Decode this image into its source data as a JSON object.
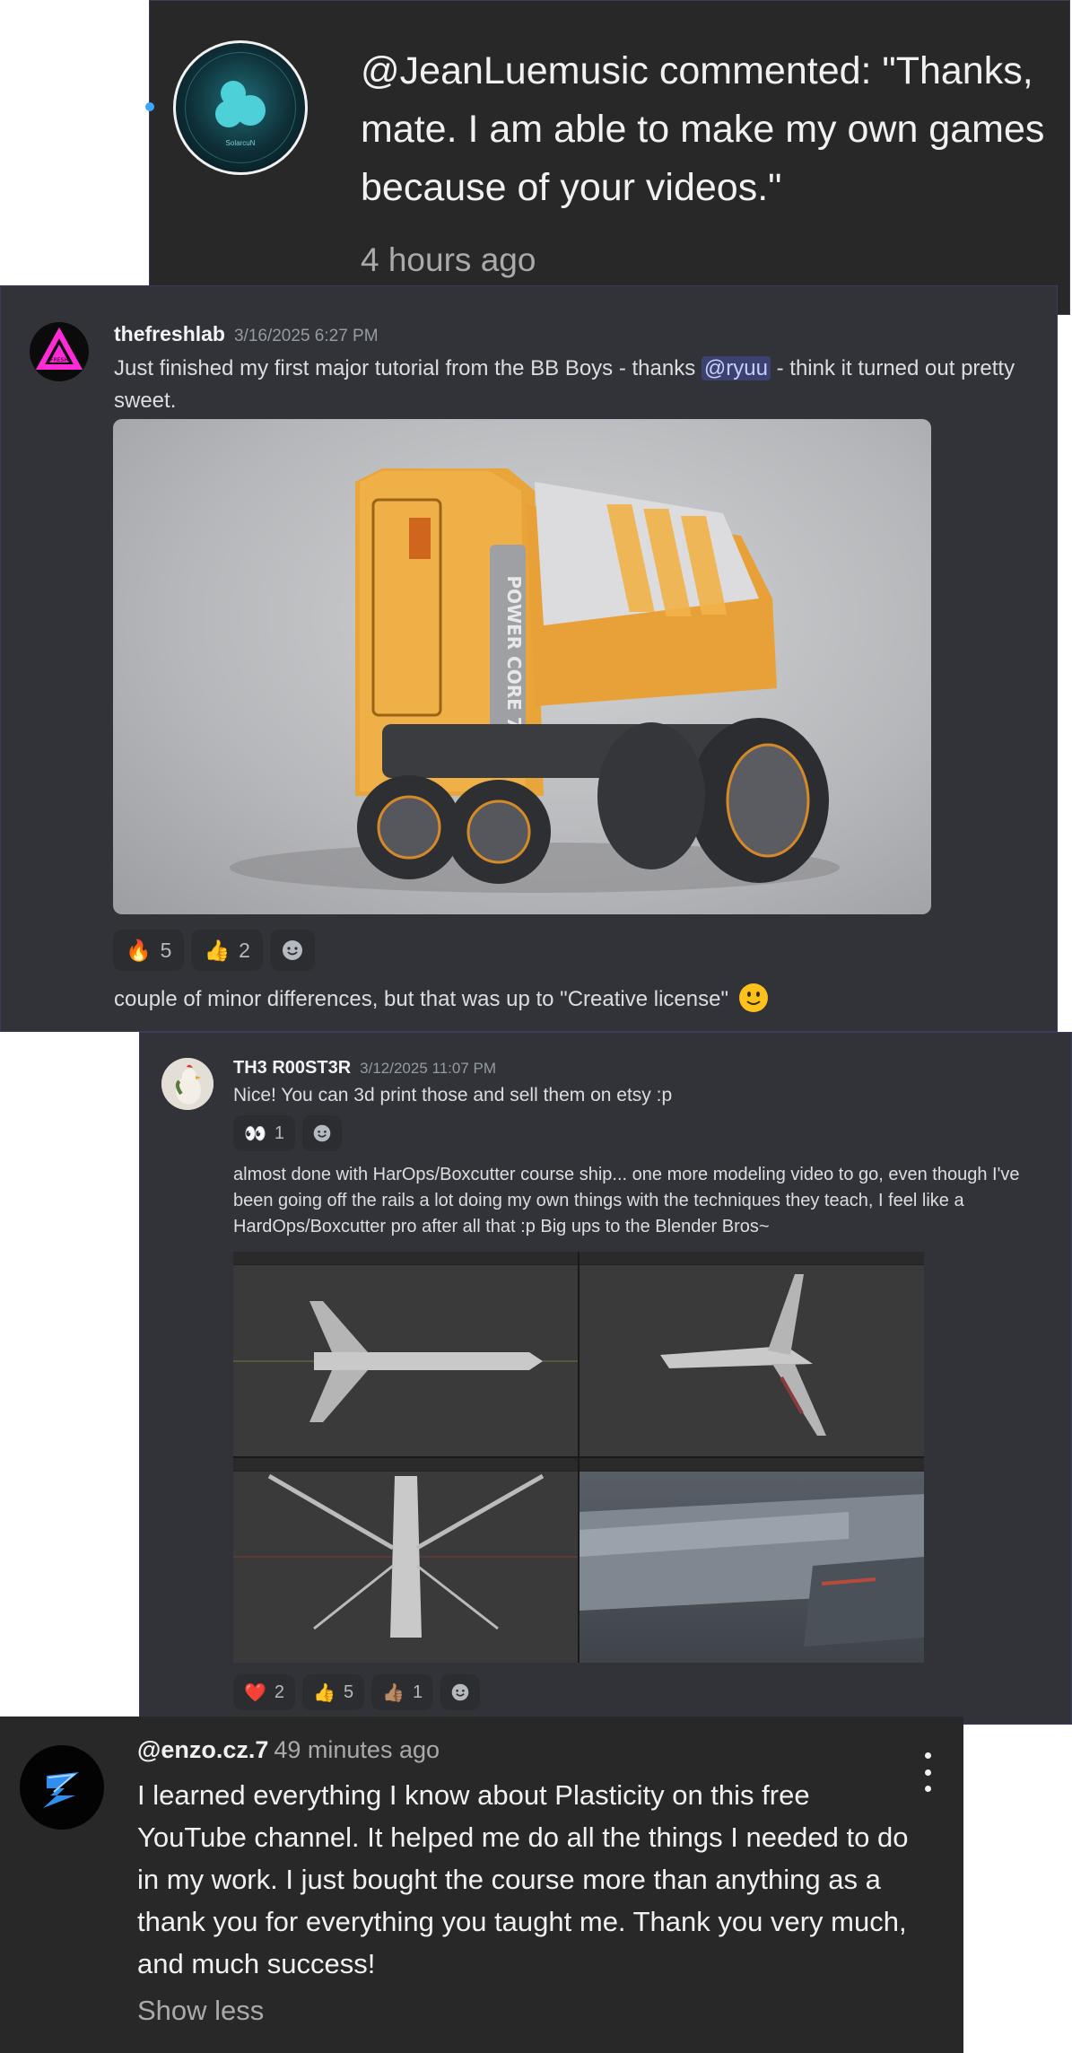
{
  "notification": {
    "message": "@JeanLuemusic commented: \"Thanks, mate. I am able to make my own games because of your videos.\"",
    "time": "4 hours ago",
    "avatar_text": "SolarcuN"
  },
  "post1": {
    "author": "thefreshlab",
    "timestamp": "3/16/2025 6:27 PM",
    "text_before": "Just finished my first major tutorial from the BB Boys - thanks ",
    "mention": "@ryuu",
    "text_after": " - think it turned out pretty sweet.",
    "image_text": "POWER CORE 7",
    "reactions": [
      {
        "emoji": "🔥",
        "count": "5"
      },
      {
        "emoji": "👍",
        "count": "2"
      }
    ],
    "followup": "couple of minor differences, but that was up to \"Creative license\""
  },
  "post2": {
    "author": "TH3 R00ST3R",
    "timestamp": "3/12/2025 11:07 PM",
    "text1": "Nice! You can 3d print those and sell them on etsy :p",
    "reactions1": [
      {
        "emoji": "👀",
        "count": "1"
      }
    ],
    "text2": "almost done with HarOps/Boxcutter course ship... one more modeling video to go, even though I've been going off the rails a lot doing my own things with the techniques they teach, I feel like a HardOps/Boxcutter pro after all that :p Big ups to the Blender Bros~",
    "reactions2": [
      {
        "emoji": "❤️",
        "count": "2"
      },
      {
        "emoji": "👍",
        "count": "5"
      },
      {
        "emoji": "👍🏽",
        "count": "1"
      }
    ]
  },
  "comment": {
    "handle": "@enzo.cz.7",
    "ago": "49 minutes ago",
    "body": "I learned everything I know about Plasticity on this free YouTube channel. It helped me do all the things I needed to do in my work. I just bought the course more than anything as a thank you for everything you taught me. Thank you very much, and much success!",
    "show_less": "Show less"
  },
  "colors": {
    "youtube_bg": "#282828",
    "discord_bg": "#313338",
    "mention_bg": "#3c4270",
    "unread_dot": "#3ea6ff"
  }
}
